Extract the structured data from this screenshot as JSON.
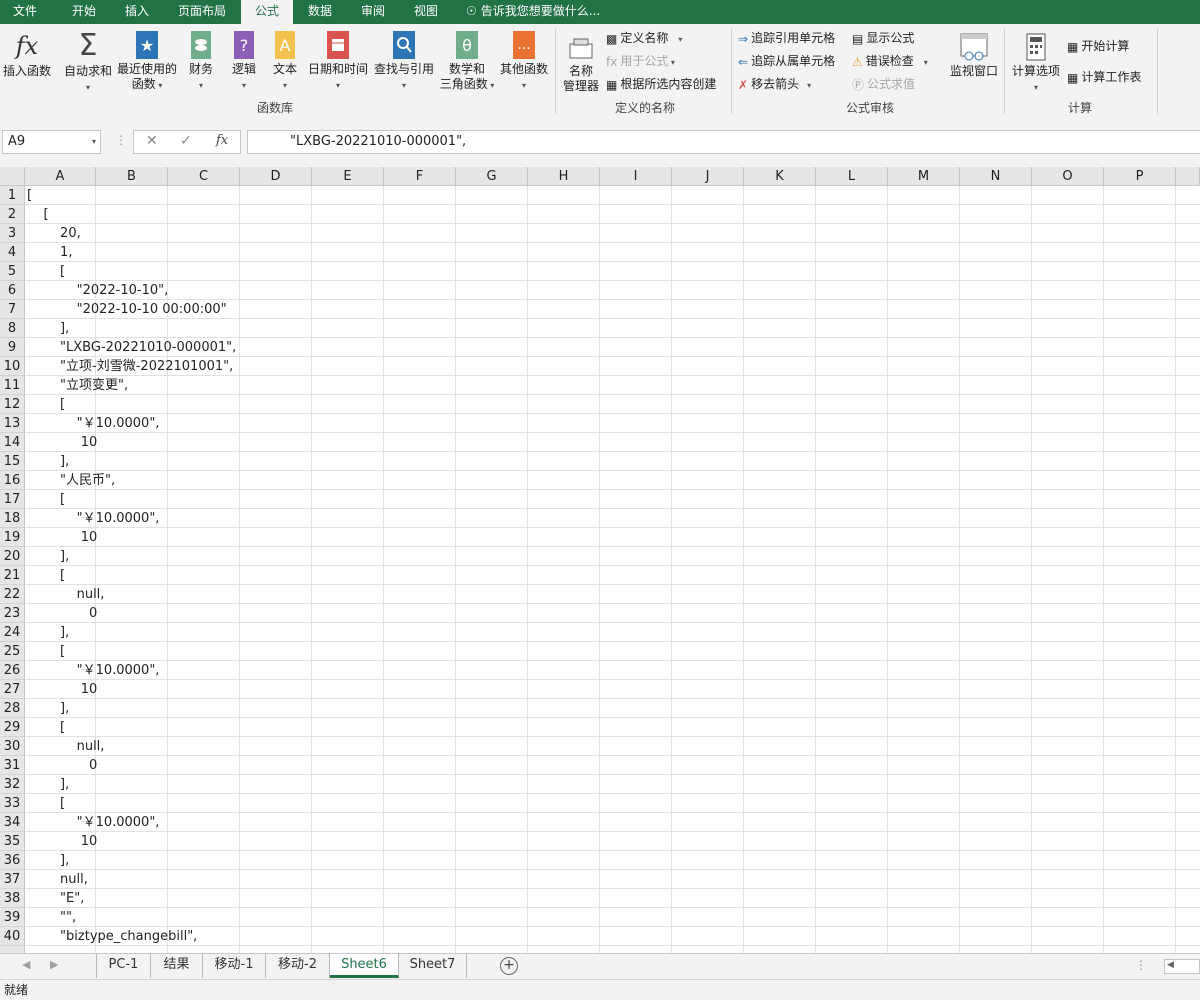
{
  "ribbon_tabs": [
    "文件",
    "开始",
    "插入",
    "页面布局",
    "公式",
    "数据",
    "审阅",
    "视图"
  ],
  "active_tab": "公式",
  "tell_me": "告诉我您想要做什么...",
  "ribbon": {
    "insert_function": "插入函数",
    "autosum": "自动求和",
    "recent_1": "最近使用的",
    "recent_2": "函数",
    "financial": "财务",
    "logical": "逻辑",
    "text": "文本",
    "datetime": "日期和时间",
    "lookup": "查找与引用",
    "math_1": "数学和",
    "math_2": "三角函数",
    "more": "其他函数",
    "group_library": "函数库",
    "name_mgr_1": "名称",
    "name_mgr_2": "管理器",
    "define_name": "定义名称",
    "use_in_formula": "用于公式",
    "create_from_sel": "根据所选内容创建",
    "group_names": "定义的名称",
    "trace_precedents": "追踪引用单元格",
    "trace_dependents": "追踪从属单元格",
    "remove_arrows": "移去箭头",
    "show_formulas": "显示公式",
    "error_check": "错误检查",
    "evaluate": "公式求值",
    "watch": "监视窗口",
    "group_audit": "公式审核",
    "calc_options": "计算选项",
    "calc_now": "开始计算",
    "calc_sheet": "计算工作表",
    "group_calc": "计算"
  },
  "formula_bar": {
    "name_box": "A9",
    "content": "\"LXBG-20221010-000001\","
  },
  "columns": [
    "A",
    "B",
    "C",
    "D",
    "E",
    "F",
    "G",
    "H",
    "I",
    "J",
    "K",
    "L",
    "M",
    "N",
    "O",
    "P"
  ],
  "row_numbers": [
    "1",
    "2",
    "3",
    "4",
    "5",
    "6",
    "7",
    "8",
    "9",
    "10",
    "11",
    "12",
    "13",
    "14",
    "15",
    "16",
    "17",
    "18",
    "19",
    "20",
    "21",
    "22",
    "23",
    "24",
    "25",
    "26",
    "27",
    "28",
    "29",
    "30",
    "31",
    "32",
    "33",
    "34",
    "35",
    "36",
    "37",
    "38",
    "39",
    "40"
  ],
  "cells": [
    "[",
    "    [",
    "        20,",
    "        1,",
    "        [",
    "            \"2022-10-10\",",
    "            \"2022-10-10 00:00:00\"",
    "        ],",
    "        \"LXBG-20221010-000001\",",
    "        \"立项-刘雪微-2022101001\",",
    "        \"立项变更\",",
    "        [",
    "            \"￥10.0000\",",
    "             10",
    "        ],",
    "        \"人民币\",",
    "        [",
    "            \"￥10.0000\",",
    "             10",
    "        ],",
    "        [",
    "            null,",
    "               0",
    "        ],",
    "        [",
    "            \"￥10.0000\",",
    "             10",
    "        ],",
    "        [",
    "            null,",
    "               0",
    "        ],",
    "        [",
    "            \"￥10.0000\",",
    "             10",
    "        ],",
    "        null,",
    "        \"E\",",
    "        \"\",",
    "        \"biztype_changebill\","
  ],
  "sheet_tabs": [
    "PC-1",
    "结果",
    "移动-1",
    "移动-2",
    "Sheet6",
    "Sheet7"
  ],
  "active_sheet": "Sheet6",
  "status": "就绪"
}
